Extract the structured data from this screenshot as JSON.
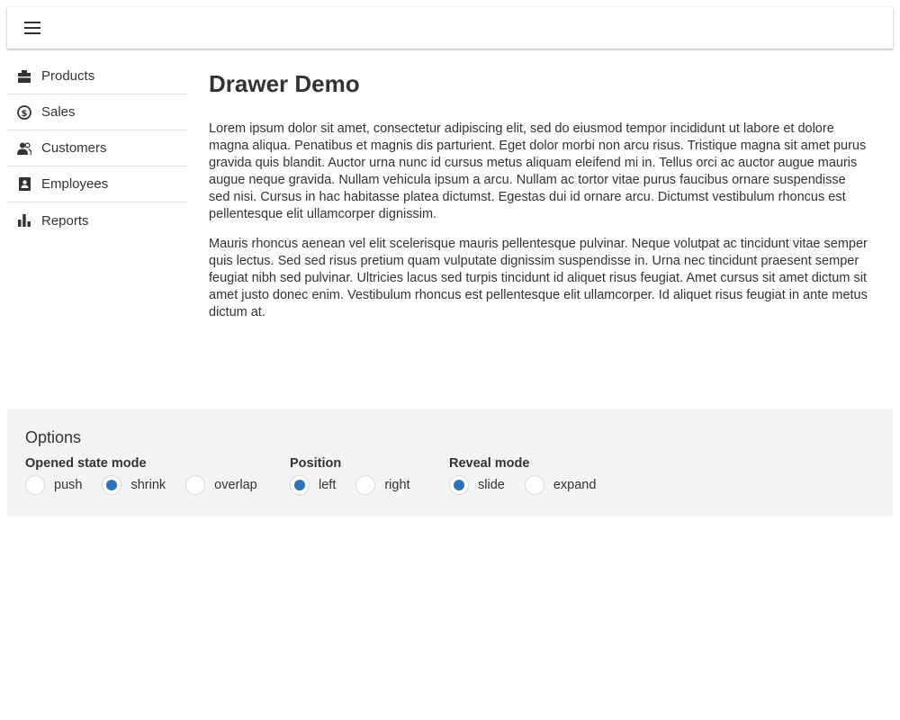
{
  "toolbar": {
    "menu_icon": "menu-icon"
  },
  "drawer": {
    "items": [
      {
        "label": "Products",
        "icon": "box-icon"
      },
      {
        "label": "Sales",
        "icon": "dollar-circle-icon"
      },
      {
        "label": "Customers",
        "icon": "users-icon"
      },
      {
        "label": "Employees",
        "icon": "id-card-icon"
      },
      {
        "label": "Reports",
        "icon": "bar-chart-icon"
      }
    ]
  },
  "content": {
    "title": "Drawer Demo",
    "paragraphs": [
      "Lorem ipsum dolor sit amet, consectetur adipiscing elit, sed do eiusmod tempor incididunt ut labore et dolore magna aliqua. Penatibus et magnis dis parturient. Eget dolor morbi non arcu risus. Tristique magna sit amet purus gravida quis blandit. Auctor urna nunc id cursus metus aliquam eleifend mi in. Tellus orci ac auctor augue mauris augue neque gravida. Nullam vehicula ipsum a arcu. Nullam ac tortor vitae purus faucibus ornare suspendisse sed nisi. Cursus in hac habitasse platea dictumst. Egestas dui id ornare arcu. Dictumst vestibulum rhoncus est pellentesque elit ullamcorper dignissim.",
      "Mauris rhoncus aenean vel elit scelerisque mauris pellentesque pulvinar. Neque volutpat ac tincidunt vitae semper quis lectus. Sed sed risus pretium quam vulputate dignissim suspendisse in. Urna nec tincidunt praesent semper feugiat nibh sed pulvinar. Ultricies lacus sed turpis tincidunt id aliquet risus feugiat. Amet cursus sit amet dictum sit amet justo donec enim. Vestibulum rhoncus est pellentesque elit ullamcorper. Id aliquet risus feugiat in ante metus dictum at."
    ]
  },
  "options": {
    "title": "Options",
    "opened_state_mode": {
      "label": "Opened state mode",
      "choices": [
        "push",
        "shrink",
        "overlap"
      ],
      "selected": "shrink"
    },
    "position": {
      "label": "Position",
      "choices": [
        "left",
        "right"
      ],
      "selected": "left"
    },
    "reveal_mode": {
      "label": "Reveal mode",
      "choices": [
        "slide",
        "expand"
      ],
      "selected": "slide"
    }
  },
  "colors": {
    "accent": "#2d73b9",
    "text": "#333333",
    "options_background": "#f4f4f4",
    "divider": "#dddddd"
  }
}
